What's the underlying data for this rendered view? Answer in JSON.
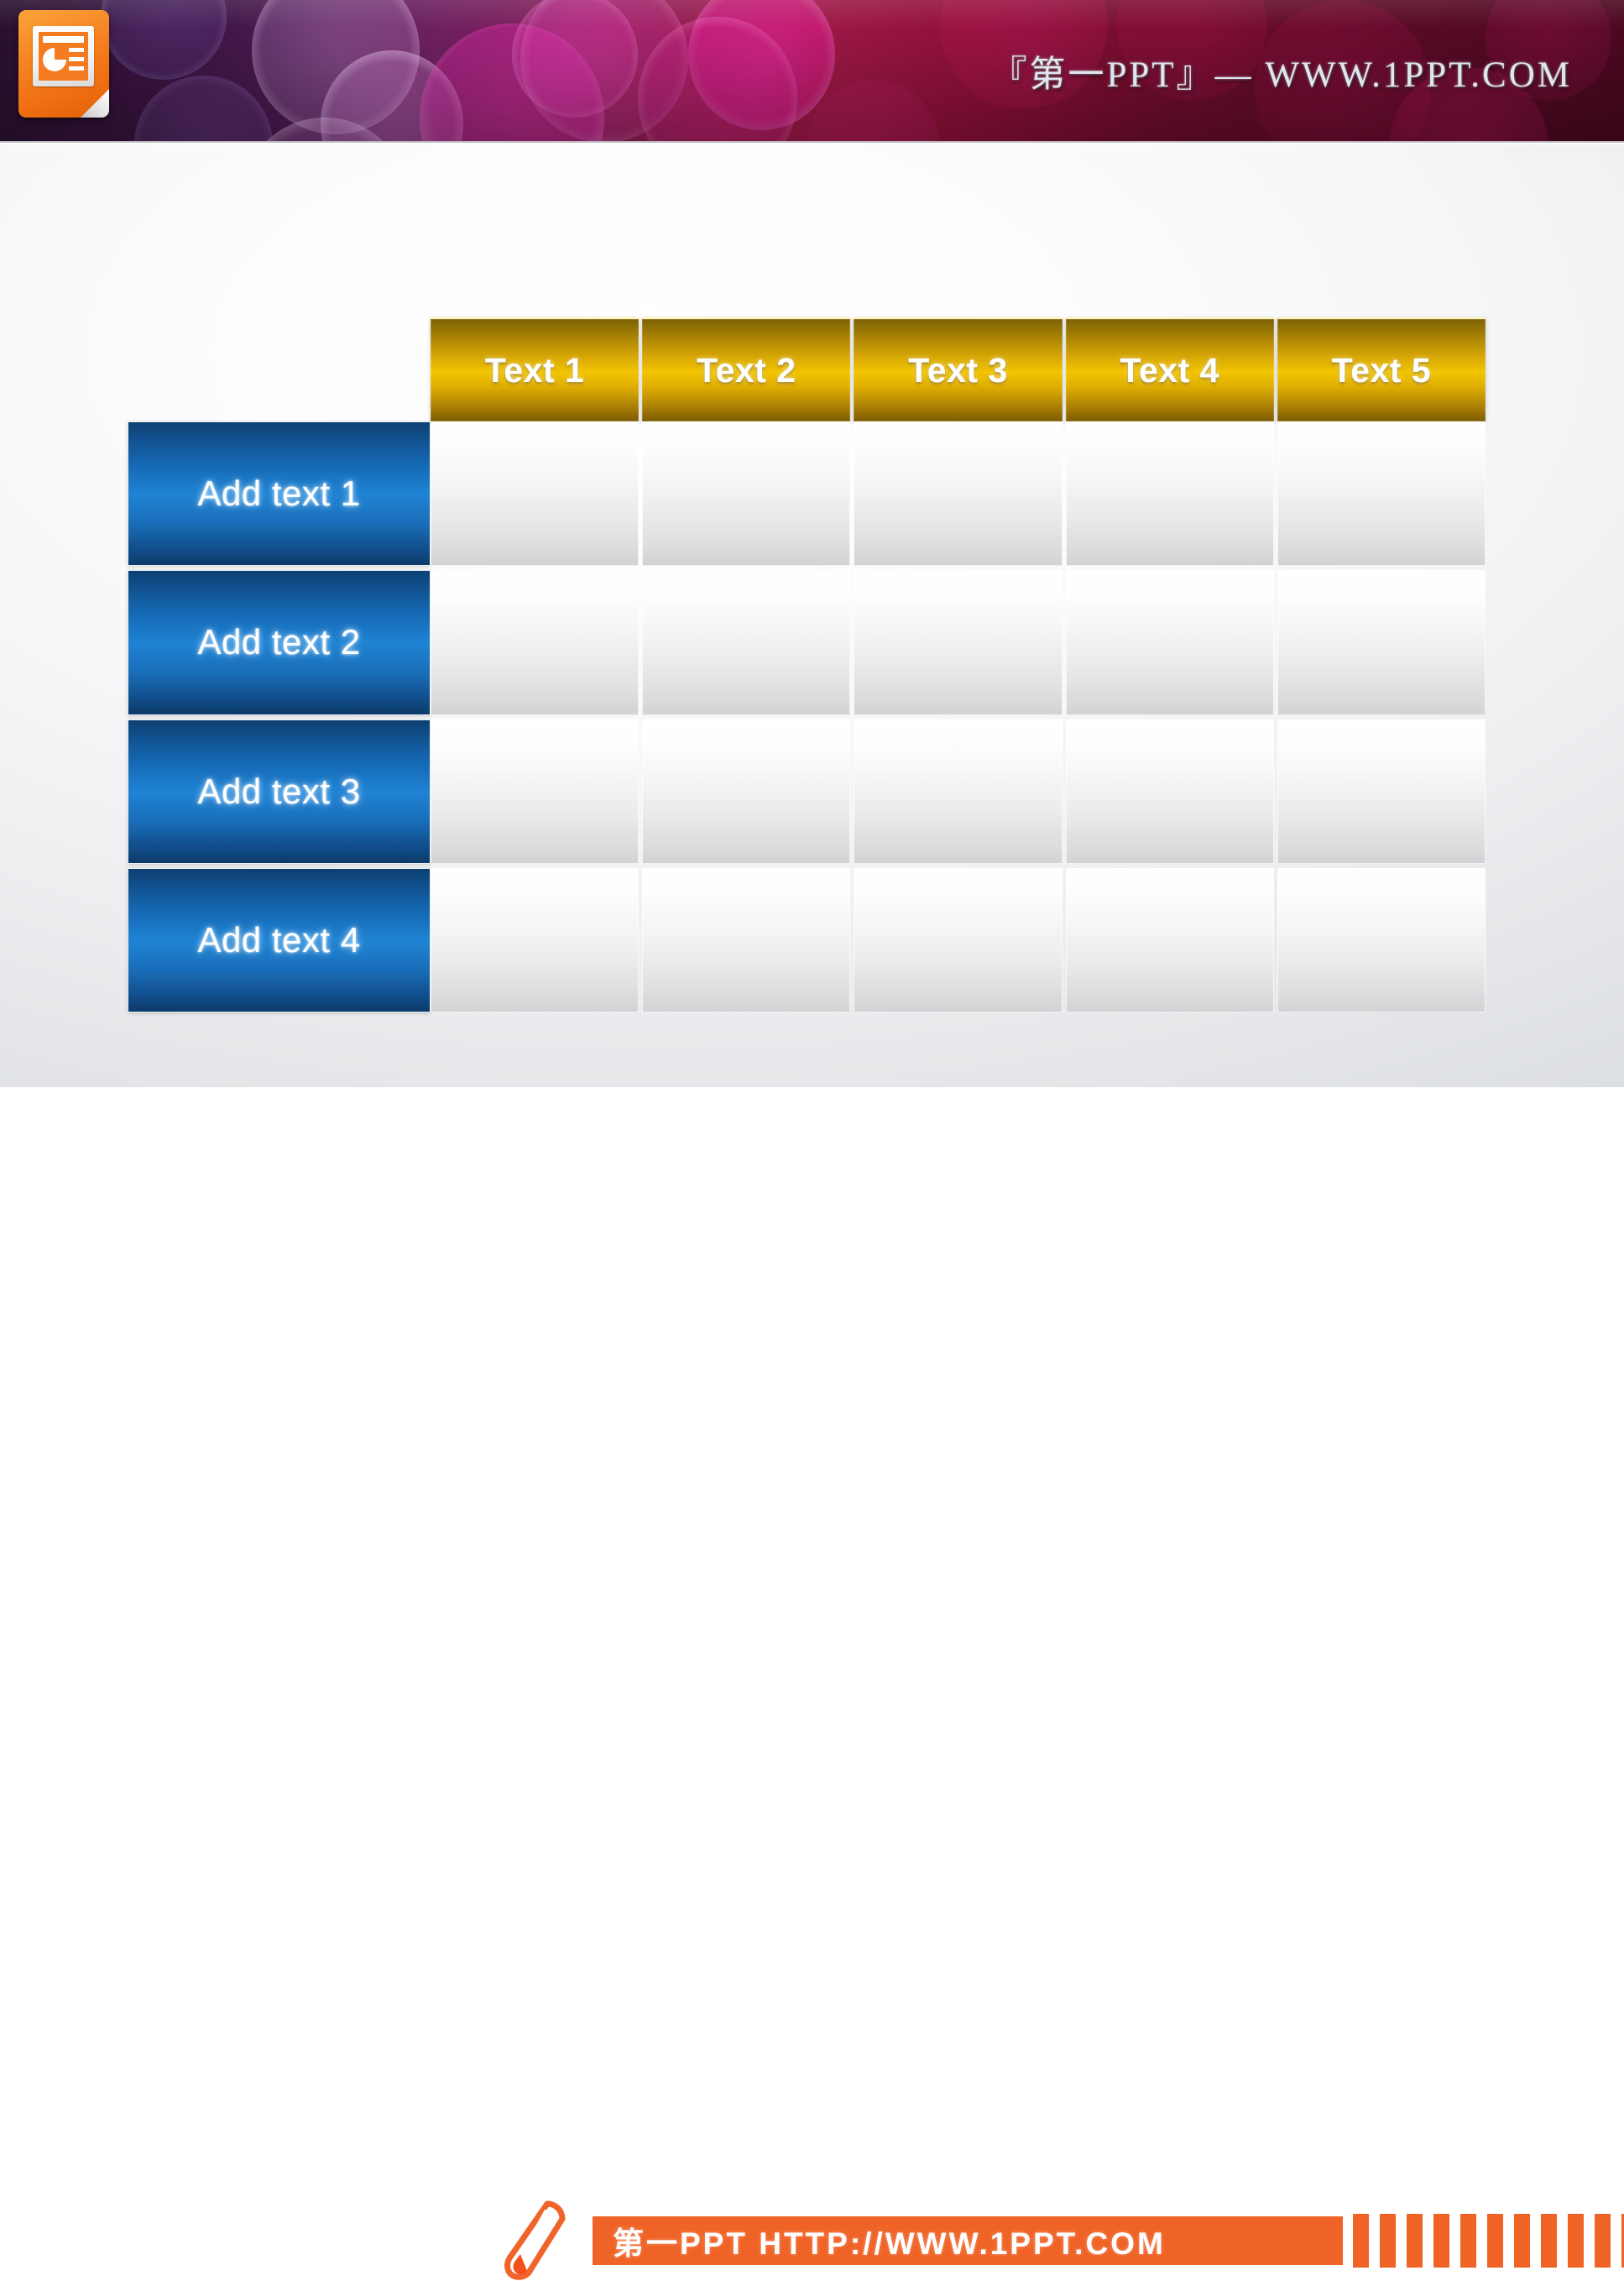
{
  "header": {
    "brand_icon": "powerpoint-file-icon",
    "title": "『第一PPT』— WWW.1PPT.COM",
    "accent_colors": {
      "bokeh_magenta": "#d4178c",
      "bokeh_purple": "#7b3a9e",
      "banner_dark_red": "#5a0a26",
      "icon_orange": "#f58220"
    }
  },
  "slide": {
    "table": {
      "corner_cell": "",
      "column_headers": [
        "Text 1",
        "Text 2",
        "Text 3",
        "Text 4",
        "Text 5"
      ],
      "row_headers": [
        "Add text 1",
        "Add text 2",
        "Add text 3",
        "Add text 4"
      ],
      "body_rows": [
        [
          "",
          "",
          "",
          "",
          ""
        ],
        [
          "",
          "",
          "",
          "",
          ""
        ],
        [
          "",
          "",
          "",
          "",
          ""
        ],
        [
          "",
          "",
          "",
          "",
          ""
        ]
      ],
      "colors": {
        "header_gold": "#f2c400",
        "header_gold_dark": "#7d6205",
        "row_header_blue": "#1f83d4",
        "row_header_blue_dark": "#0d3f72",
        "body_cell_light": "#ffffff",
        "body_cell_shade": "#d2d2d5"
      }
    }
  },
  "footer": {
    "pencil_icon": "pencil-icon",
    "banner_text": "第一PPT HTTP://WWW.1PPT.COM",
    "banner_color": "#f06327",
    "tick_count": 12
  }
}
